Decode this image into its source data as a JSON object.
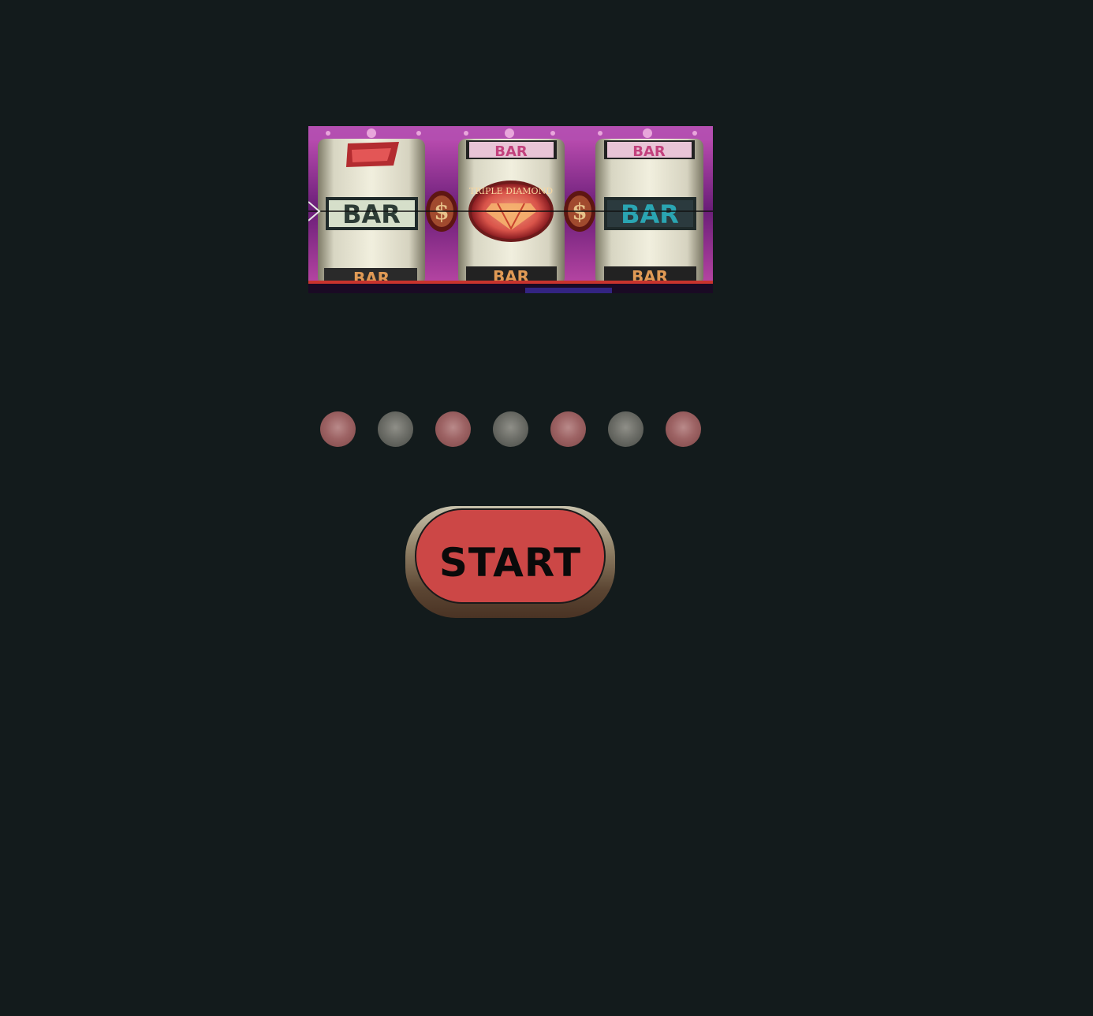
{
  "reels": [
    {
      "top": "",
      "middle": "BAR",
      "bottom": "BAR"
    },
    {
      "top": "BAR",
      "middle": "TRIPLE DIAMOND",
      "bottom": "BAR"
    },
    {
      "top": "BAR",
      "middle": "BAR",
      "bottom": "BAR"
    }
  ],
  "dividers": [
    "$",
    "$"
  ],
  "lights": [
    {
      "color": "red"
    },
    {
      "color": "grey"
    },
    {
      "color": "red"
    },
    {
      "color": "grey"
    },
    {
      "color": "red"
    },
    {
      "color": "grey"
    },
    {
      "color": "red"
    }
  ],
  "controls": {
    "start_label": "START"
  },
  "colors": {
    "background": "#131b1c",
    "start_button": "#cc4746",
    "light_red": "#9d6364",
    "light_grey": "#6d6e68"
  }
}
